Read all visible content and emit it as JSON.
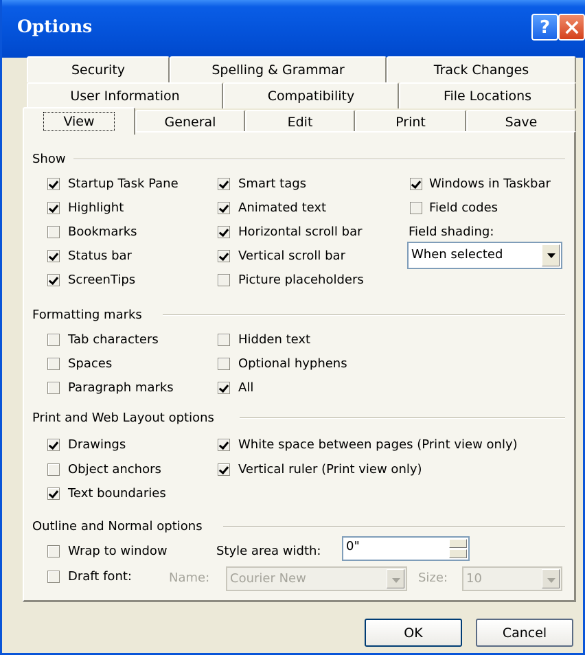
{
  "window": {
    "title": "Options"
  },
  "tabs": {
    "row1": [
      "Security",
      "Spelling & Grammar",
      "Track Changes"
    ],
    "row2": [
      "User Information",
      "Compatibility",
      "File Locations"
    ],
    "row3": [
      "View",
      "General",
      "Edit",
      "Print",
      "Save"
    ]
  },
  "show": {
    "label": "Show",
    "startup_task_pane": "Startup Task Pane",
    "highlight": "Highlight",
    "bookmarks": "Bookmarks",
    "status_bar": "Status bar",
    "screentips": "ScreenTips",
    "smart_tags": "Smart tags",
    "animated_text": "Animated text",
    "horizontal_scroll_bar": "Horizontal scroll bar",
    "vertical_scroll_bar": "Vertical scroll bar",
    "picture_placeholders": "Picture placeholders",
    "windows_in_taskbar": "Windows in Taskbar",
    "field_codes": "Field codes",
    "field_shading_label": "Field shading:",
    "field_shading_value": "When selected"
  },
  "formatting": {
    "label": "Formatting marks",
    "tab_characters": "Tab characters",
    "spaces": "Spaces",
    "paragraph_marks": "Paragraph marks",
    "hidden_text": "Hidden text",
    "optional_hyphens": "Optional hyphens",
    "all": "All"
  },
  "print_web": {
    "label": "Print and Web Layout options",
    "drawings": "Drawings",
    "object_anchors": "Object anchors",
    "text_boundaries": "Text boundaries",
    "white_space": "White space between pages (Print view only)",
    "vertical_ruler": "Vertical ruler (Print view only)"
  },
  "outline": {
    "label": "Outline and Normal options",
    "wrap_to_window": "Wrap to window",
    "draft_font": "Draft font:",
    "style_area_label": "Style area width:",
    "style_area_value": "0\"",
    "name_label": "Name:",
    "name_value": "Courier New",
    "size_label": "Size:",
    "size_value": "10"
  },
  "buttons": {
    "ok": "OK",
    "cancel": "Cancel"
  },
  "colors": {
    "titlebar": "#0453da",
    "dialog_bg": "#ece9d8",
    "close": "#d4411c"
  }
}
